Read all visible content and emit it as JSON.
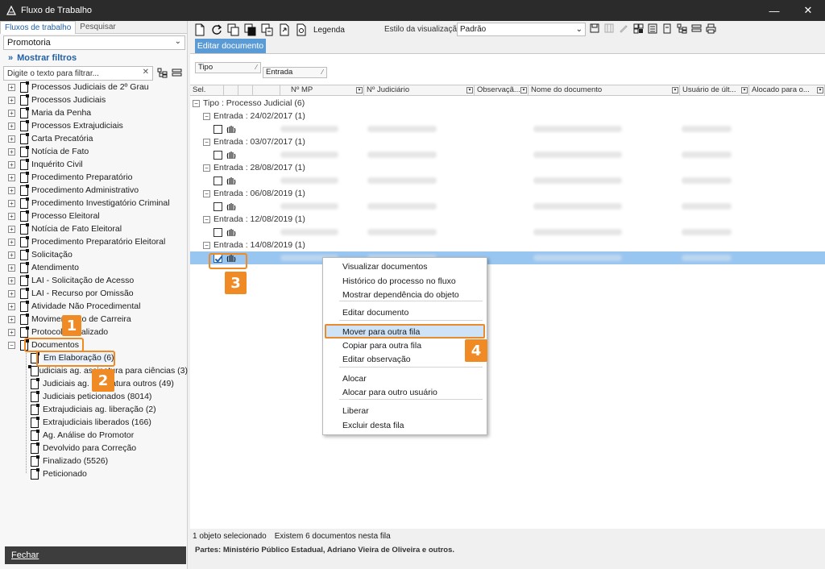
{
  "window": {
    "title": "Fluxo de Trabalho",
    "minimize": "—",
    "close": "✕"
  },
  "left": {
    "tabs": [
      "Fluxos de trabalho",
      "Pesquisar"
    ],
    "combo_value": "Promotoria",
    "show_filters": "Mostrar filtros",
    "filter_placeholder": "Digite o texto para filtrar...",
    "tree": [
      "Processos Judiciais de 2º Grau",
      "Processos Judiciais",
      "Maria da Penha",
      "Processos Extrajudiciais",
      "Carta Precatória",
      "Notícia de Fato",
      "Inquérito Civil",
      "Procedimento Preparatório",
      "Procedimento Administrativo",
      "Procedimento Investigatório Criminal",
      "Processo Eleitoral",
      "Notícia de Fato Eleitoral",
      "Procedimento Preparatório Eleitoral",
      "Solicitação",
      "Atendimento",
      "LAI - Solicitação de Acesso",
      "LAI - Recurso por Omissão",
      "Atividade Não Procedimental",
      "Movimentação de Carreira",
      "Protocolo Finalizado",
      "Documentos"
    ],
    "children": [
      "Em Elaboração (6)",
      "Judiciais ag. assinatura para ciências (3)",
      "Judiciais ag. assinatura outros (49)",
      "Judiciais peticionados (8014)",
      "Extrajudiciais ag. liberação (2)",
      "Extrajudiciais liberados (166)",
      "Ag. Análise do Promotor",
      "Devolvido para Correção",
      "Finalizado (5526)",
      "Peticionado"
    ],
    "close_button": "Fechar"
  },
  "toolbar": {
    "legend": "Legenda",
    "style_label": "Estilo da visualização",
    "style_value": "Padrão"
  },
  "edit_tab": "Editar documento",
  "grid": {
    "group_chips": [
      "Tipo",
      "Entrada"
    ],
    "columns": [
      "Sel.",
      "",
      "",
      "",
      "Nº MP",
      "Nº Judiciário",
      "Observaçã...",
      "Nome do documento",
      "Usuário de últ...",
      "Alocado para o..."
    ],
    "type_group": "Tipo : Processo Judicial  (6)",
    "entry_groups": [
      "Entrada : 24/02/2017  (1)",
      "Entrada : 03/07/2017  (1)",
      "Entrada : 28/08/2017  (1)",
      "Entrada : 06/08/2019  (1)",
      "Entrada : 12/08/2019  (1)",
      "Entrada : 14/08/2019  (1)"
    ]
  },
  "status": {
    "selected": "1 objeto selecionado",
    "count": "Existem 6 documentos nesta fila",
    "parts": "Partes: Ministério Público Estadual, Adriano Vieira de Oliveira e outros."
  },
  "context_menu": {
    "items": [
      "Visualizar documentos",
      "Histórico do processo no fluxo",
      "Mostrar dependência do objeto",
      "Editar documento",
      "Mover para outra fila",
      "Copiar para outra fila",
      "Editar observação",
      "Alocar",
      "Alocar para outro usuário",
      "Liberar",
      "Excluir desta fila"
    ],
    "highlighted": "Mover para outra fila"
  },
  "annotations": {
    "c1": "1",
    "c2": "2",
    "c3": "3",
    "c4": "4"
  },
  "colors": {
    "accent": "#f08a24",
    "selection": "#99c6f0",
    "link": "#1f5fa8",
    "titlebar": "#2b2b2b"
  }
}
